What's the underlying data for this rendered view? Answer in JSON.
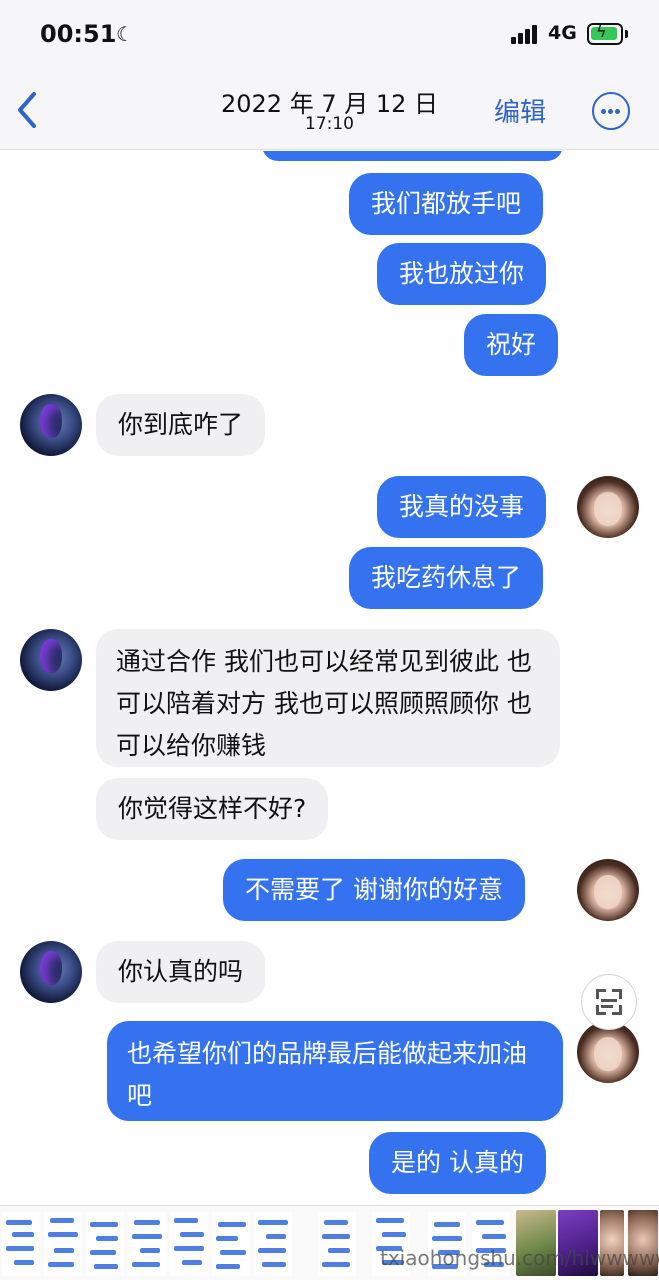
{
  "status_bar": {
    "time": "00:51",
    "network": "4G",
    "icons": [
      "moon-icon",
      "signal-icon",
      "battery-charging-icon"
    ]
  },
  "nav": {
    "date": "2022 年 7 月 12 日",
    "time": "17:10",
    "edit_label": "编辑",
    "icons": [
      "back-chevron-icon",
      "more-ellipsis-icon"
    ]
  },
  "messages": [
    {
      "side": "out",
      "text": "我们都放手吧"
    },
    {
      "side": "out",
      "text": "我也放过你"
    },
    {
      "side": "out",
      "text": "祝好"
    },
    {
      "side": "in",
      "text": "你到底咋了"
    },
    {
      "side": "out",
      "text": "我真的没事"
    },
    {
      "side": "out",
      "text": "我吃药休息了"
    },
    {
      "side": "in",
      "text": "通过合作 我们也可以经常见到彼此 也可以陪着对方 我也可以照顾照顾你 也可以给你赚钱"
    },
    {
      "side": "in",
      "text": "你觉得这样不好?"
    },
    {
      "side": "out",
      "text": "不需要了 谢谢你的好意"
    },
    {
      "side": "in",
      "text": "你认真的吗"
    },
    {
      "side": "out",
      "text": "也希望你们的品牌最后能做起来加油吧"
    },
    {
      "side": "out",
      "text": "是的 认真的"
    }
  ],
  "colors": {
    "outgoing_bubble": "#3472f0",
    "incoming_bubble": "#f0f0f2",
    "accent": "#2f64c8",
    "header_bg": "#f6f6f8"
  },
  "watermark": "txiaohongshu.com/hlwwwww"
}
